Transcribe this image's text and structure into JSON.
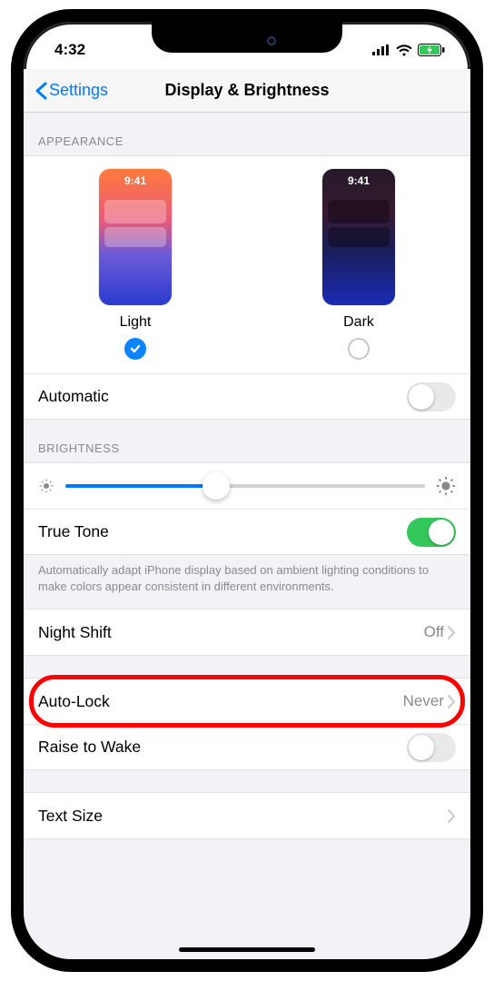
{
  "status": {
    "time": "4:32"
  },
  "nav": {
    "back": "Settings",
    "title": "Display & Brightness"
  },
  "appearance": {
    "header": "APPEARANCE",
    "thumb_time": "9:41",
    "light": {
      "label": "Light",
      "selected": true
    },
    "dark": {
      "label": "Dark",
      "selected": false
    },
    "automatic_label": "Automatic",
    "automatic_on": false
  },
  "brightness": {
    "header": "BRIGHTNESS",
    "slider_pct": 42,
    "true_tone_label": "True Tone",
    "true_tone_on": true,
    "footer": "Automatically adapt iPhone display based on ambient lighting conditions to make colors appear consistent in different environments."
  },
  "night_shift": {
    "label": "Night Shift",
    "value": "Off"
  },
  "auto_lock": {
    "label": "Auto-Lock",
    "value": "Never",
    "highlighted": true
  },
  "raise_to_wake": {
    "label": "Raise to Wake",
    "on": false
  },
  "text_size": {
    "label": "Text Size"
  }
}
